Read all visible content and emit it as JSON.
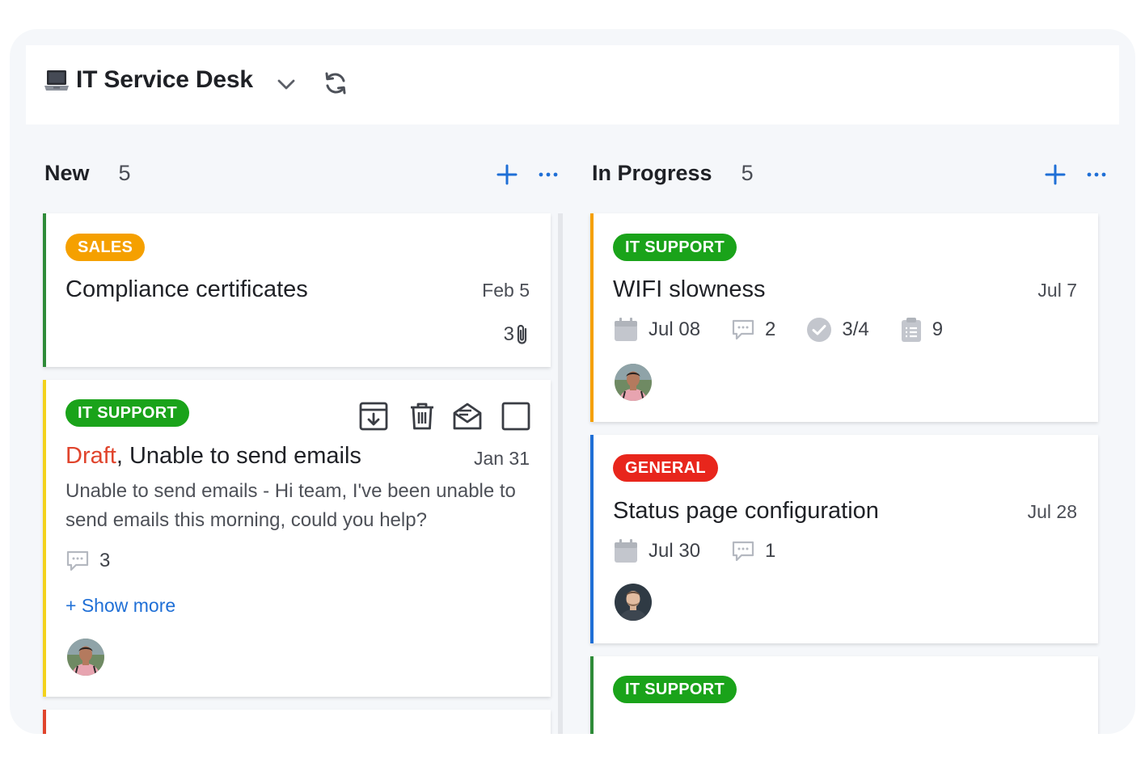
{
  "board": {
    "title": "IT Service Desk",
    "icons": [
      "laptop-icon",
      "chevron-down-icon",
      "refresh-icon"
    ]
  },
  "colors": {
    "accent": "#1f6fd6",
    "sales": "#f5a000",
    "it_support": "#1aa31a",
    "general": "#e8261c",
    "yellow_bar": "#f3d21c",
    "green_bar": "#2e8b38",
    "orange_bar": "#f5a000",
    "blue_bar": "#1f6fd6",
    "red_bar": "#e0442c"
  },
  "columns": [
    {
      "title": "New",
      "count": "5",
      "cards": [
        {
          "tag": "SALES",
          "title": "Compliance certificates",
          "date": "Feb 5",
          "attachments": "3"
        },
        {
          "tag": "IT SUPPORT",
          "draft_label": "Draft",
          "title_sep": ", ",
          "title": "Unable to send emails",
          "date": "Jan 31",
          "description": "Unable to send emails - Hi team, I've been unable to send emails this morning, could you help?",
          "comments": "3",
          "show_more": "+ Show more",
          "actions": [
            "archive-icon",
            "trash-icon",
            "open-mail-icon",
            "checkbox-icon"
          ]
        }
      ]
    },
    {
      "title": "In Progress",
      "count": "5",
      "cards": [
        {
          "tag": "IT SUPPORT",
          "title": "WIFI slowness",
          "date": "Jul 7",
          "due": "Jul 08",
          "comments": "2",
          "checklist": "3/4",
          "tasks": "9"
        },
        {
          "tag": "GENERAL",
          "title": "Status page configuration",
          "date": "Jul 28",
          "due": "Jul 30",
          "comments": "1"
        },
        {
          "tag": "IT SUPPORT"
        }
      ]
    }
  ]
}
